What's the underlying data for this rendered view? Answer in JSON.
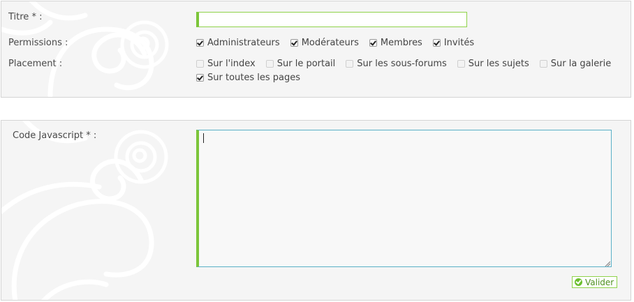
{
  "form_top": {
    "title_label": "Titre * :",
    "title_value": "",
    "permissions_label": "Permissions :",
    "permissions": [
      {
        "label": "Administrateurs",
        "checked": true
      },
      {
        "label": "Modérateurs",
        "checked": true
      },
      {
        "label": "Membres",
        "checked": true
      },
      {
        "label": "Invités",
        "checked": true
      }
    ],
    "placement_label": "Placement :",
    "placements": [
      {
        "label": "Sur l'index",
        "checked": false
      },
      {
        "label": "Sur le portail",
        "checked": false
      },
      {
        "label": "Sur les sous-forums",
        "checked": false
      },
      {
        "label": "Sur les sujets",
        "checked": false
      },
      {
        "label": "Sur la galerie",
        "checked": false
      }
    ],
    "placement_all": {
      "label": "Sur toutes les pages",
      "checked": true
    }
  },
  "form_bottom": {
    "code_label": "Code Javascript * :",
    "code_value": "",
    "submit_label": "Valider",
    "submit_icon": "check-circle-icon"
  },
  "colors": {
    "accent_green": "#7cc53a",
    "textarea_focus_border": "#5ab0c7",
    "panel_bg": "#f5f5f5"
  }
}
